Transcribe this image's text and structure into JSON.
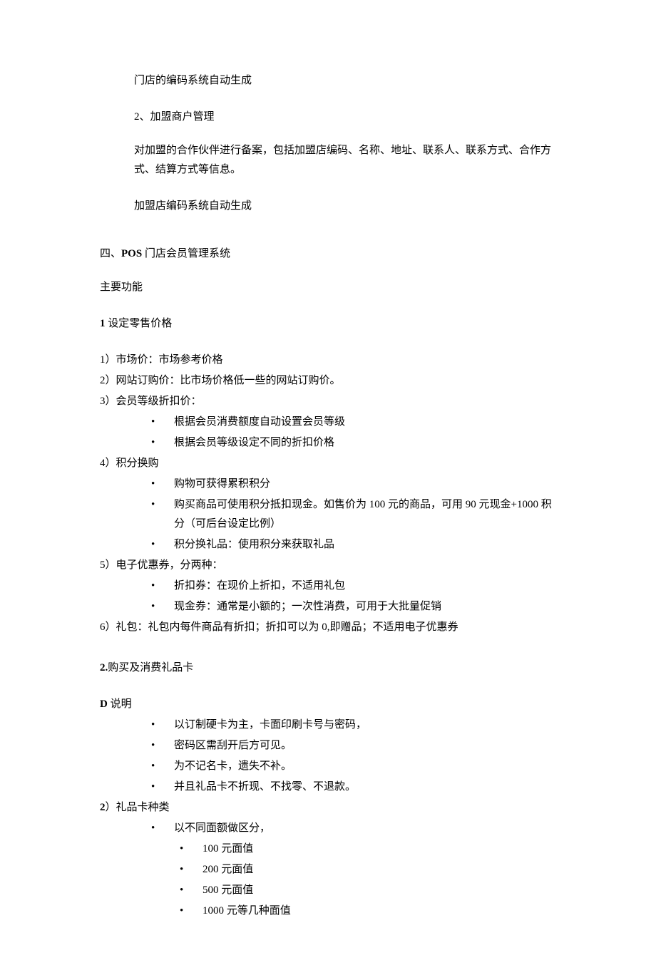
{
  "block1": {
    "line1": "门店的编码系统自动生成",
    "item2_title": "2、加盟商户管理",
    "item2_desc": "对加盟的合作伙伴进行备案，包括加盟店编码、名称、地址、联系人、联系方式、合作方式、结算方式等信息。",
    "item2_note": "加盟店编码系统自动生成"
  },
  "section4": {
    "title_prefix": "四、",
    "title_bold": "POS",
    "title_suffix": " 门店会员管理系统",
    "subtitle": "主要功能"
  },
  "func1": {
    "heading_num": "1",
    "heading_text": " 设定零售价格",
    "item1": "1）市场价：市场参考价格",
    "item2": "2）网站订购价：比市场价格低一些的网站订购价。",
    "item3": "3）会员等级折扣价：",
    "item3_b1": "根据会员消费额度自动设置会员等级",
    "item3_b2": "根据会员等级设定不同的折扣价格",
    "item4": "4）积分换购",
    "item4_b1": "购物可获得累积积分",
    "item4_b2": "购买商品可使用积分抵扣现金。如售价为 100 元的商品，可用 90 元现金+1000 积分（可后台设定比例）",
    "item4_b3": "积分换礼品：使用积分来获取礼品",
    "item5": "5）电子优惠券，分两种：",
    "item5_b1": "折扣券：在现价上折扣，不适用礼包",
    "item5_b2": "现金券：通常是小额的；一次性消费，可用于大批量促销",
    "item6": "6）礼包：礼包内每件商品有折扣；折扣可以为 0,即赠品；不适用电子优惠券"
  },
  "func2": {
    "heading_num": "2.",
    "heading_text": "购买及消费礼品卡",
    "d_heading_prefix": "D",
    "d_heading_text": " 说明",
    "d_b1": "以订制硬卡为主，卡面印刷卡号与密码，",
    "d_b2": "密码区需刮开后方可见。",
    "d_b3": "为不记名卡，遗失不补。",
    "d_b4": "并且礼品卡不折现、不找零、不退款。",
    "item2_num": "2",
    "item2_text": "）礼品卡种类",
    "item2_b1": "以不同面额做区分，",
    "item2_n1": "100 元面值",
    "item2_n2": "200 元面值",
    "item2_n3": "500 元面值",
    "item2_n4": "1000 元等几种面值"
  }
}
